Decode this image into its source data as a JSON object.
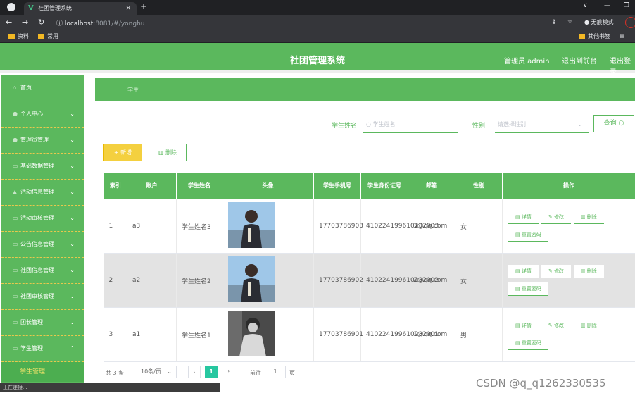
{
  "browser": {
    "tab_title": "社团管理系统",
    "url_host": "localhost",
    "url_rest": ":8081/#/yonghu",
    "incognito": "无痕模式",
    "bookmarks": [
      "资料",
      "常用"
    ],
    "other_bookmarks": "其他书签"
  },
  "header": {
    "title": "社团管理系统",
    "admin": "管理员 admin",
    "back_front": "退出到前台",
    "logout": "退出登录"
  },
  "sidebar": {
    "items": [
      {
        "label": "首页",
        "icon": "home-icon"
      },
      {
        "label": "个人中心",
        "icon": "user-icon"
      },
      {
        "label": "管理员管理",
        "icon": "admin-icon"
      },
      {
        "label": "基础数据管理",
        "icon": "data-icon"
      },
      {
        "label": "活动信息管理",
        "icon": "activity-icon"
      },
      {
        "label": "活动审核管理",
        "icon": "review-icon"
      },
      {
        "label": "公告信息管理",
        "icon": "notice-icon"
      },
      {
        "label": "社团信息管理",
        "icon": "club-icon"
      },
      {
        "label": "社团审核管理",
        "icon": "audit-icon"
      },
      {
        "label": "团长管理",
        "icon": "leader-icon"
      },
      {
        "label": "学生管理",
        "icon": "student-icon"
      }
    ],
    "sub": "学生管理"
  },
  "breadcrumb": "学生",
  "filters": {
    "name_label": "学生姓名",
    "name_placeholder": "学生姓名",
    "gender_label": "性别",
    "gender_placeholder": "请选择性别",
    "query": "查询"
  },
  "buttons": {
    "add": "+ 新增",
    "delete": "删除"
  },
  "table": {
    "headers": [
      "索引",
      "账户",
      "学生姓名",
      "头像",
      "学生手机号",
      "学生身份证号",
      "邮箱",
      "性别",
      "操作"
    ],
    "rows": [
      {
        "index": "1",
        "account": "a3",
        "name": "学生姓名3",
        "phone": "17703786903",
        "idcard": "410224199610232003",
        "email": "3@qq.com",
        "gender": "女"
      },
      {
        "index": "2",
        "account": "a2",
        "name": "学生姓名2",
        "phone": "17703786902",
        "idcard": "410224199610232002",
        "email": "2@qq.com",
        "gender": "女"
      },
      {
        "index": "3",
        "account": "a1",
        "name": "学生姓名1",
        "phone": "17703786901",
        "idcard": "410224199610232001",
        "email": "1@qq.com",
        "gender": "男"
      }
    ],
    "ops": {
      "detail": "详情",
      "edit": "修改",
      "delete": "删除",
      "reset": "重置密码"
    }
  },
  "pager": {
    "total": "共 3 条",
    "page_size": "10条/页",
    "current": "1",
    "goto_label": "前往",
    "goto_value": "1",
    "page_unit": "页"
  },
  "status_text": "正在连接...",
  "watermark": "CSDN @q_q1262330535"
}
